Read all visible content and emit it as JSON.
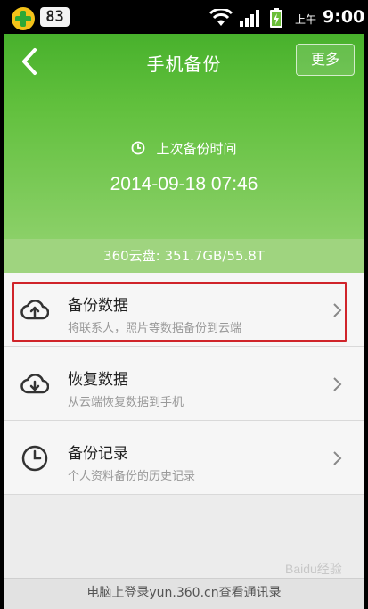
{
  "status_bar": {
    "badge": "83",
    "ampm": "上午",
    "time": "9:00"
  },
  "header": {
    "title": "手机备份",
    "more_label": "更多",
    "last_backup_label": "上次备份时间",
    "last_backup_time": "2014-09-18 07:46"
  },
  "storage": {
    "text": "360云盘: 351.7GB/55.8T"
  },
  "list": {
    "items": [
      {
        "title": "备份数据",
        "subtitle": "将联系人，照片等数据备份到云端",
        "icon": "cloud-upload-icon"
      },
      {
        "title": "恢复数据",
        "subtitle": "从云端恢复数据到手机",
        "icon": "cloud-download-icon"
      },
      {
        "title": "备份记录",
        "subtitle": "个人资料备份的历史记录",
        "icon": "clock-icon"
      }
    ]
  },
  "footer": {
    "text": "电脑上登录yun.360.cn查看通讯录"
  },
  "watermark": "Baidu经验",
  "colors": {
    "header_green": "#48b12c",
    "highlight_red": "#d0242a"
  }
}
